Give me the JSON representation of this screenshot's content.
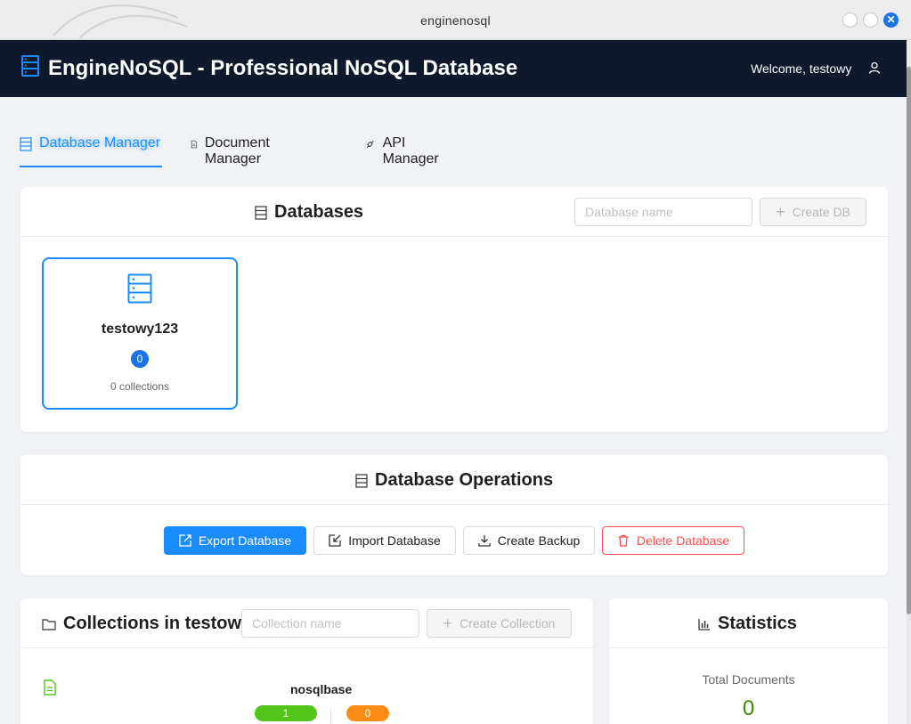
{
  "window": {
    "title": "enginenosql"
  },
  "header": {
    "title": "EngineNoSQL - Professional NoSQL Database",
    "welcome": "Welcome, testowy"
  },
  "tabs": [
    {
      "label": "Database Manager"
    },
    {
      "label": "Document Manager"
    },
    {
      "label": "API Manager"
    }
  ],
  "databases": {
    "title": "Databases",
    "input_placeholder": "Database name",
    "create_label": "Create DB",
    "items": [
      {
        "name": "testowy123",
        "count": "0",
        "sub": "0 collections"
      }
    ]
  },
  "operations": {
    "title": "Database Operations",
    "export_label": "Export Database",
    "import_label": "Import Database",
    "backup_label": "Create Backup",
    "delete_label": "Delete Database"
  },
  "collections": {
    "title": "Collections in testow",
    "input_placeholder": "Collection name",
    "create_label": "Create Collection",
    "items": [
      {
        "name": "nosqlbase",
        "green_value": "1",
        "orange_value": "0"
      }
    ]
  },
  "statistics": {
    "title": "Statistics",
    "total_label": "Total Documents",
    "total_value": "0"
  },
  "colors": {
    "accent": "#1a8cff",
    "header_bg": "#0e1a2b",
    "danger": "#ff4d4f",
    "green": "#52c41a",
    "orange": "#fa8c16"
  }
}
